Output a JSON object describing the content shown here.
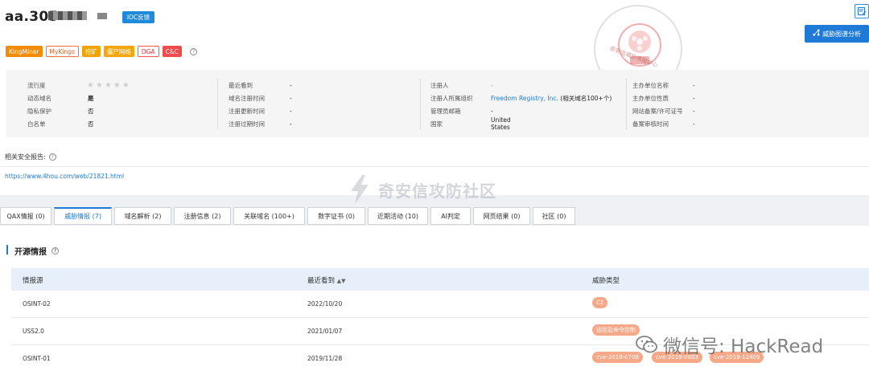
{
  "header": {
    "domain": "aa.305",
    "ioc_feedback": "IOC反馈",
    "graph_analysis": "威胁图谱分析"
  },
  "tags": [
    "KingMiner",
    "MyKings",
    "挖矿",
    "僵尸网络",
    "DGA",
    "C&C"
  ],
  "stamp": {
    "text": "奇安信威胁情报中心",
    "center_text": "恶意"
  },
  "info": {
    "col1": [
      {
        "k": "流行度",
        "v": ""
      },
      {
        "k": "动态域名",
        "v": "是"
      },
      {
        "k": "隐私保护",
        "v": "否"
      },
      {
        "k": "白名单",
        "v": "否"
      }
    ],
    "popularity_stars": 0,
    "col2": [
      {
        "k": "最近看到",
        "v": "-"
      },
      {
        "k": "域名注册时间",
        "v": "-"
      },
      {
        "k": "注册更新时间",
        "v": "-"
      },
      {
        "k": "注册过期时间",
        "v": "-"
      }
    ],
    "col3": [
      {
        "k": "注册人",
        "v": "-"
      },
      {
        "k": "注册人所属组织",
        "v_link": "Freedom Registry, Inc.",
        "v_extra": "(相关域名100+个)"
      },
      {
        "k": "管理员邮箱",
        "v": "-"
      },
      {
        "k": "国家",
        "v": "United States"
      }
    ],
    "col4": [
      {
        "k": "主办单位名称",
        "v": "-"
      },
      {
        "k": "主办单位性质",
        "v": "-"
      },
      {
        "k": "网站备案/许可证号",
        "v": "-"
      },
      {
        "k": "备案审核时间",
        "v": "-"
      }
    ]
  },
  "report": {
    "label": "相关安全报告:",
    "link": "https://www.4hou.com/web/21821.html"
  },
  "watermark_center": "奇安信攻防社区",
  "tabs": [
    {
      "label": "QAX情报 (0)"
    },
    {
      "label": "威胁情报 (7)"
    },
    {
      "label": "域名解析 (2)"
    },
    {
      "label": "注册信息 (2)"
    },
    {
      "label": "关联域名 (100+)"
    },
    {
      "label": "数字证书 (0)"
    },
    {
      "label": "近期活动 (10)"
    },
    {
      "label": "AI判定"
    },
    {
      "label": "网页结果 (0)"
    },
    {
      "label": "社区 (0)"
    }
  ],
  "osint": {
    "title": "开源情报",
    "columns": [
      "情报源",
      "最近看到",
      "威胁类型"
    ],
    "rows": [
      {
        "source": "OSINT-02",
        "date": "2022/10/20",
        "types": [
          "C2"
        ]
      },
      {
        "source": "USS2.0",
        "date": "2021/01/07",
        "types": [
          "远控及命令控制"
        ]
      },
      {
        "source": "OSINT-01",
        "date": "2019/11/28",
        "types": [
          "cve-2019-0708",
          "cve-2019-0803",
          "cve-2019-12409"
        ]
      }
    ]
  },
  "wechat_watermark": "微信号: HackRead"
}
